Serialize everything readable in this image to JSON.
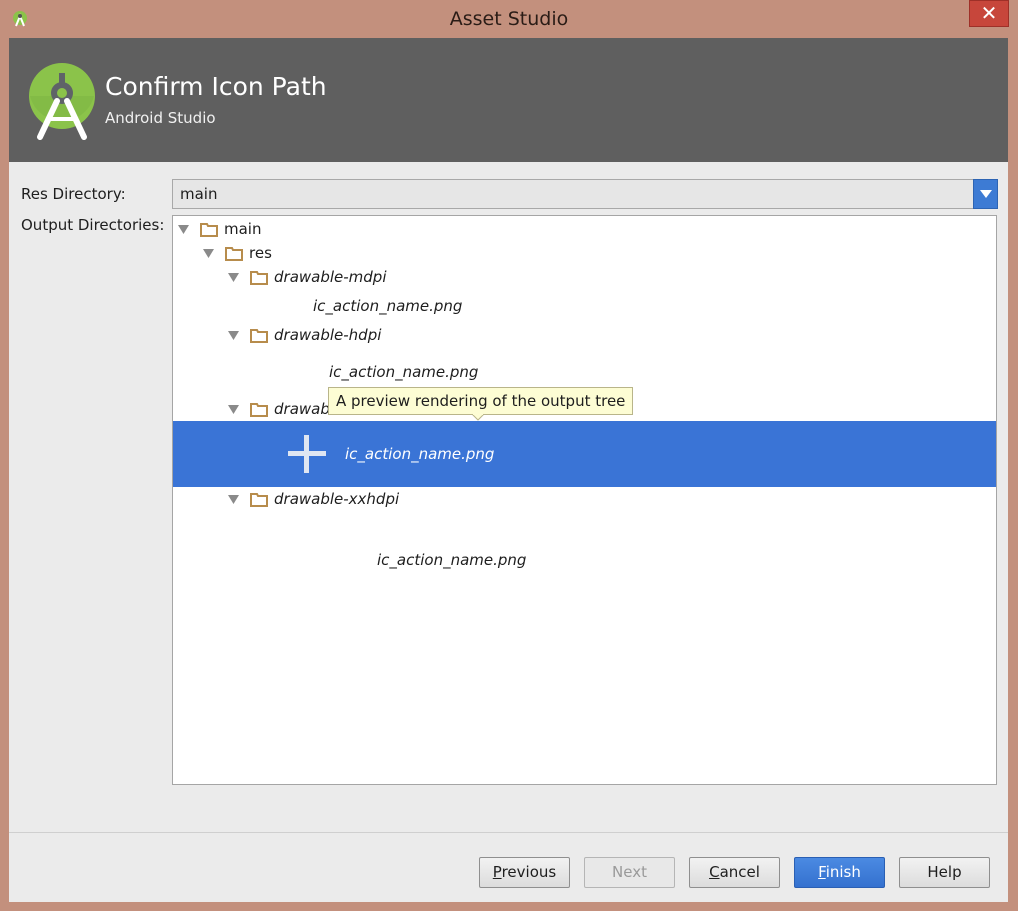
{
  "window": {
    "title": "Asset Studio",
    "close_glyph": "✕"
  },
  "header": {
    "title": "Confirm Icon Path",
    "subtitle": "Android Studio"
  },
  "form": {
    "res_directory_label": "Res Directory:",
    "res_directory_value": "main",
    "output_directories_label": "Output Directories:"
  },
  "tree": {
    "root": "main",
    "res": "res",
    "folders": [
      "drawable-mdpi",
      "drawable-hdpi",
      "drawable-xhdpi",
      "drawable-xxhdpi"
    ],
    "file_name": "ic_action_name.png",
    "visible_partial_folder": "drawab"
  },
  "tooltip": "A preview rendering of the output tree",
  "buttons": {
    "previous": {
      "mnemonic": "P",
      "rest": "revious"
    },
    "next": "Next",
    "cancel": {
      "mnemonic": "C",
      "rest": "ancel"
    },
    "finish": {
      "mnemonic": "F",
      "rest": "inish"
    },
    "help": "Help"
  },
  "colors": {
    "selection": "#3a74d6",
    "header_background": "#5f5f5f",
    "android_green": "#8bc34a",
    "tooltip_background": "#fdfdd4"
  },
  "icons": [
    "android-studio-icon",
    "close-icon",
    "dropdown-arrow-icon",
    "expand-triangle-icon",
    "folder-icon",
    "plus-icon"
  ]
}
